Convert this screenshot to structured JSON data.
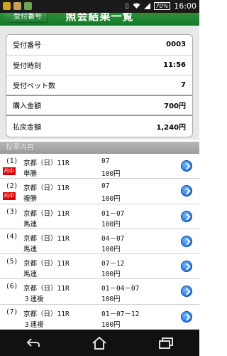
{
  "status_bar": {
    "time": "16:00",
    "battery": "70%",
    "icons": [
      "notification-icon",
      "app-icon",
      "app-icon-2",
      "vibrate-icon",
      "wifi-icon",
      "signal-icon",
      "battery-icon"
    ]
  },
  "header": {
    "back_label": "受付番号",
    "title": "照会結果一覧",
    "colors": {
      "bar": "#137a25"
    }
  },
  "summary": {
    "rows": [
      {
        "label": "受付番号",
        "value": "0003"
      },
      {
        "label": "受付時刻",
        "value": "11:56"
      },
      {
        "label": "受付ベット数",
        "value": "7"
      },
      {
        "label": "購入金額",
        "value": "700円"
      },
      {
        "label": "払戻金額",
        "value": "1,240円"
      }
    ]
  },
  "bets": {
    "section_title": "投票内容",
    "hit_badge": "的中",
    "rows": [
      {
        "num": "(1)",
        "race": "京都（日）11R",
        "type": "単勝",
        "combo": "07",
        "amount": "100円",
        "hit": true
      },
      {
        "num": "(2)",
        "race": "京都（日）11R",
        "type": "複勝",
        "combo": "07",
        "amount": "100円",
        "hit": true
      },
      {
        "num": "(3)",
        "race": "京都（日）11R",
        "type": "馬連",
        "combo": "01－07",
        "amount": "100円",
        "hit": false
      },
      {
        "num": "(4)",
        "race": "京都（日）11R",
        "type": "馬連",
        "combo": "04－07",
        "amount": "100円",
        "hit": false
      },
      {
        "num": "(5)",
        "race": "京都（日）11R",
        "type": "馬連",
        "combo": "07－12",
        "amount": "100円",
        "hit": false
      },
      {
        "num": "(6)",
        "race": "京都（日）11R",
        "type": "３連複",
        "combo": "01－04－07",
        "amount": "100円",
        "hit": false
      },
      {
        "num": "(7)",
        "race": "京都（日）11R",
        "type": "３連複",
        "combo": "01－07－12",
        "amount": "100円",
        "hit": false
      }
    ]
  },
  "navbar": {
    "icons": [
      "back-icon",
      "home-icon",
      "recent-apps-icon"
    ]
  }
}
